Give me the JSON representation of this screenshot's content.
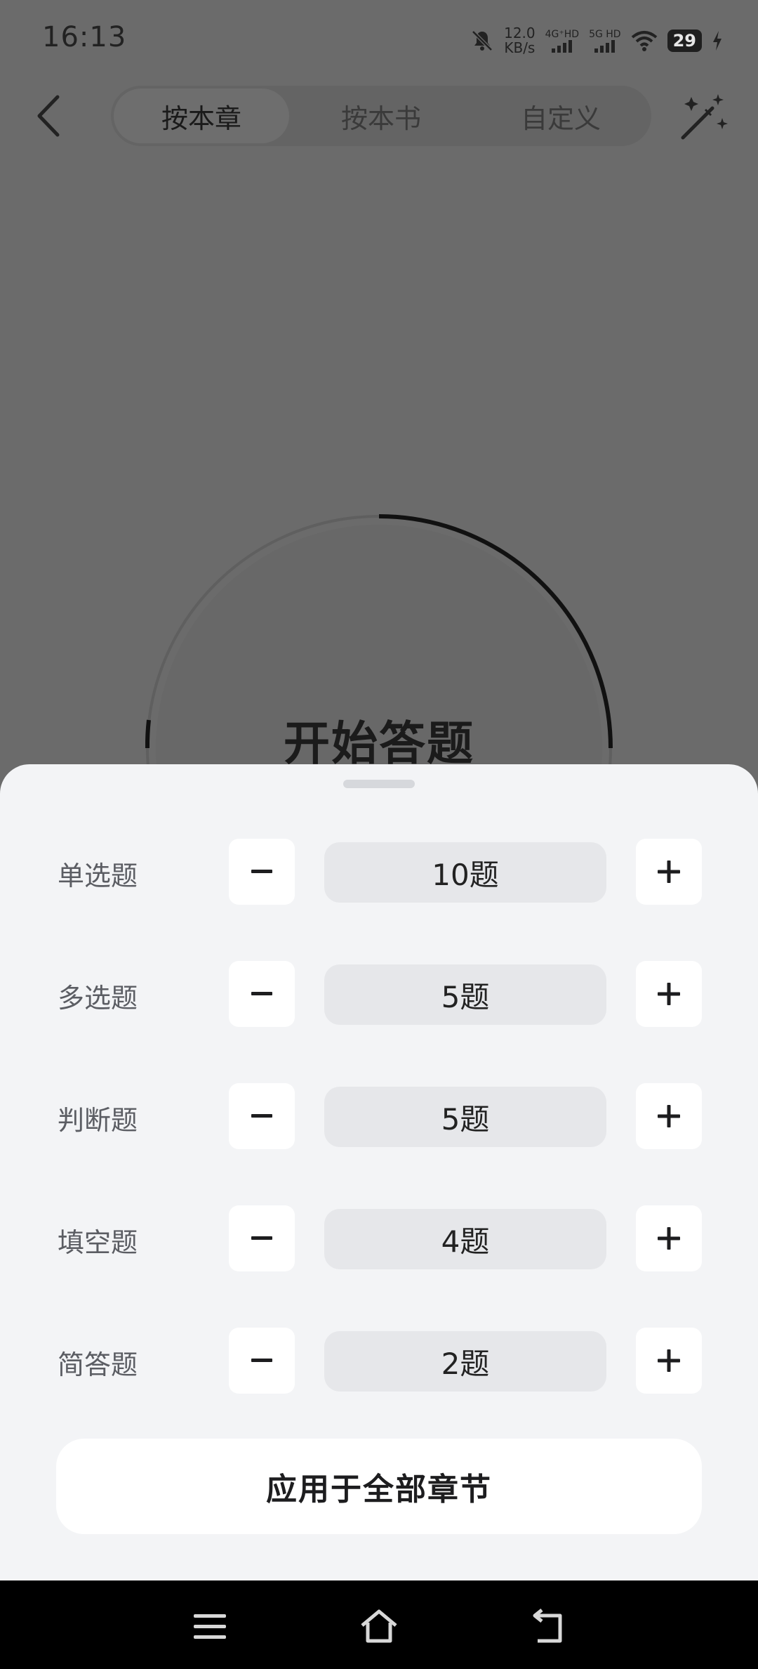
{
  "status_bar": {
    "time": "16:13",
    "net_speed_value": "12.0",
    "net_speed_unit": "KB/s",
    "sim1_label": "4G⁺HD",
    "sim2_label": "5G HD",
    "battery": "29"
  },
  "nav": {
    "tabs": [
      {
        "label": "按本章",
        "active": true
      },
      {
        "label": "按本书",
        "active": false
      },
      {
        "label": "自定义",
        "active": false
      }
    ]
  },
  "start": {
    "title": "开始答题"
  },
  "sheet": {
    "rows": [
      {
        "label": "单选题",
        "count": "10题"
      },
      {
        "label": "多选题",
        "count": "5题"
      },
      {
        "label": "判断题",
        "count": "5题"
      },
      {
        "label": "填空题",
        "count": "4题"
      },
      {
        "label": "简答题",
        "count": "2题"
      }
    ],
    "apply_label": "应用于全部章节"
  },
  "icons": {
    "back": "chevron-left-icon",
    "magic": "magic-wand-icon",
    "minus": "minus-icon",
    "plus": "plus-icon",
    "menu": "menu-icon",
    "home": "home-icon",
    "system_back": "system-back-icon"
  },
  "colors": {
    "overlay_bg": "#6b6b6b",
    "sheet_bg": "#f3f4f6",
    "count_bg": "#e6e7ea",
    "button_bg": "#ffffff"
  }
}
